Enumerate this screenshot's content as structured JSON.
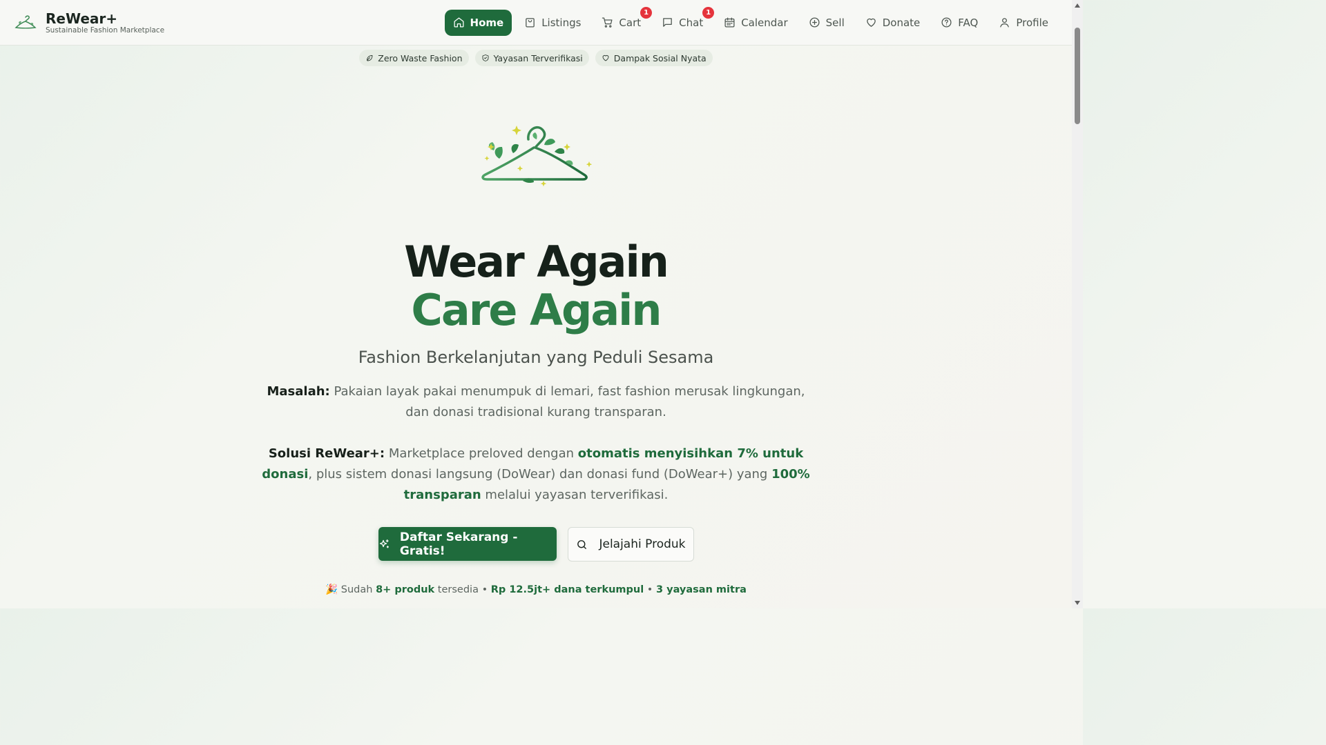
{
  "brand": {
    "name": "ReWear+",
    "tagline": "Sustainable Fashion Marketplace",
    "logo_icon": "hanger-leaf-logo"
  },
  "nav": {
    "items": [
      {
        "label": "Home",
        "icon": "home-icon",
        "active": true
      },
      {
        "label": "Listings",
        "icon": "bag-icon"
      },
      {
        "label": "Cart",
        "icon": "cart-icon",
        "badge": "1"
      },
      {
        "label": "Chat",
        "icon": "chat-icon",
        "badge": "1"
      },
      {
        "label": "Calendar",
        "icon": "calendar-icon"
      },
      {
        "label": "Sell",
        "icon": "plus-circle-icon"
      },
      {
        "label": "Donate",
        "icon": "heart-icon"
      },
      {
        "label": "FAQ",
        "icon": "help-circle-icon"
      },
      {
        "label": "Profile",
        "icon": "user-icon"
      }
    ]
  },
  "pills": [
    {
      "label": "Zero Waste Fashion",
      "icon": "leaf-icon"
    },
    {
      "label": "Yayasan Terverifikasi",
      "icon": "shield-check-icon"
    },
    {
      "label": "Dampak Sosial Nyata",
      "icon": "heart-icon"
    }
  ],
  "hero": {
    "title_line1": "Wear Again",
    "title_line2": "Care Again",
    "subtitle": "Fashion Berkelanjutan yang Peduli Sesama",
    "problem_label": "Masalah:",
    "problem_text": "Pakaian layak pakai menumpuk di lemari, fast fashion merusak lingkungan, dan donasi tradisional kurang transparan.",
    "solution_label": "Solusi ReWear+:",
    "solution_text_a": "Marketplace preloved dengan ",
    "solution_highlight_a": "otomatis menyisihkan 7% untuk donasi",
    "solution_text_b": ", plus sistem donasi langsung (DoWear) dan donasi fund (DoWear+) yang ",
    "solution_highlight_b": "100% transparan",
    "solution_text_c": " melalui yayasan terverifikasi."
  },
  "buttons": {
    "register": "Daftar Sekarang - Gratis!",
    "explore": "Jelajahi Produk"
  },
  "stats": {
    "emoji": "🎉",
    "prefix": "Sudah ",
    "products": "8+ produk",
    "available": " tersedia • ",
    "funds": "Rp 12.5jt+ dana terkumpul",
    "sep": " • ",
    "partners": "3 yayasan mitra"
  },
  "colors": {
    "primary": "#1f6b3c",
    "accent_green": "#2e7d48",
    "badge_red": "#e5343c"
  }
}
